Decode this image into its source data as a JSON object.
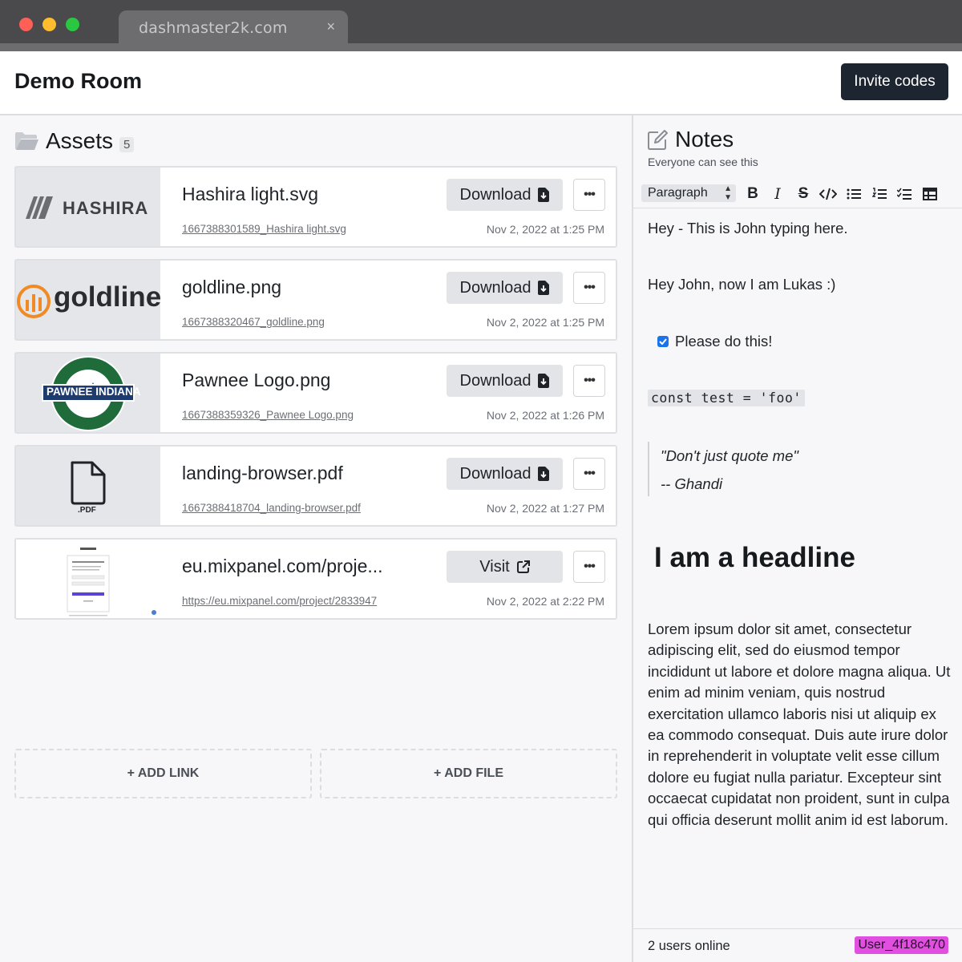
{
  "browser": {
    "tab_title": "dashmaster2k.com",
    "close_glyph": "×"
  },
  "header": {
    "title": "Demo Room",
    "invite_label": "Invite codes"
  },
  "assets": {
    "title": "Assets",
    "count": "5",
    "items": [
      {
        "name": "Hashira light.svg",
        "file": "1667388301589_Hashira light.svg",
        "date": "Nov 2, 2022 at 1:25 PM",
        "action": "Download",
        "thumb_text": "HASHIRA"
      },
      {
        "name": "goldline.png",
        "file": "1667388320467_goldline.png",
        "date": "Nov 2, 2022 at 1:25 PM",
        "action": "Download",
        "thumb_text": "goldline"
      },
      {
        "name": "Pawnee Logo.png",
        "file": "1667388359326_Pawnee Logo.png",
        "date": "Nov 2, 2022 at 1:26 PM",
        "action": "Download",
        "thumb_text": "PAWNEE INDIANA"
      },
      {
        "name": "landing-browser.pdf",
        "file": "1667388418704_landing-browser.pdf",
        "date": "Nov 2, 2022 at 1:27 PM",
        "action": "Download",
        "thumb_text": ".PDF"
      },
      {
        "name": "eu.mixpanel.com/proje...",
        "file": "https://eu.mixpanel.com/project/2833947",
        "date": "Nov 2, 2022 at 2:22 PM",
        "action": "Visit"
      }
    ],
    "add_link_label": "+ ADD LINK",
    "add_file_label": "+ ADD FILE"
  },
  "notes": {
    "title": "Notes",
    "subtitle": "Everyone can see this",
    "block_type": "Paragraph",
    "toolbar_icons": [
      "bold-icon",
      "italic-icon",
      "strikethrough-icon",
      "code-icon",
      "bullet-list-icon",
      "numbered-list-icon",
      "checklist-icon",
      "table-icon"
    ],
    "content": {
      "p1": "Hey - This is John typing here.",
      "p2": "Hey John, now I am Lukas :)",
      "todo": "Please do this!",
      "todo_checked": true,
      "code": "const test = 'foo'",
      "quote_line1": "\"Don't just quote me\"",
      "quote_line2": "-- Ghandi",
      "headline": "I am a headline",
      "lorem": "Lorem ipsum dolor sit amet, consectetur adipiscing elit, sed do eiusmod tempor incididunt ut labore et dolore magna aliqua. Ut enim ad minim veniam, quis nostrud exercitation ullamco laboris nisi ut aliquip ex ea commodo consequat. Duis aute irure dolor in reprehenderit in voluptate velit esse cillum dolore eu fugiat nulla pariatur. Excepteur sint occaecat cupidatat non proident, sunt in culpa qui officia deserunt mollit anim id est laborum."
    },
    "footer": {
      "online": "2 users online",
      "user": "User_4f18c470"
    }
  },
  "colors": {
    "primary_button": "#1d2530",
    "user_badge": "#e04fe0",
    "checkbox": "#1a73e8",
    "goldline_orange": "#f08a24",
    "pawnee_green": "#1f6b3a"
  }
}
